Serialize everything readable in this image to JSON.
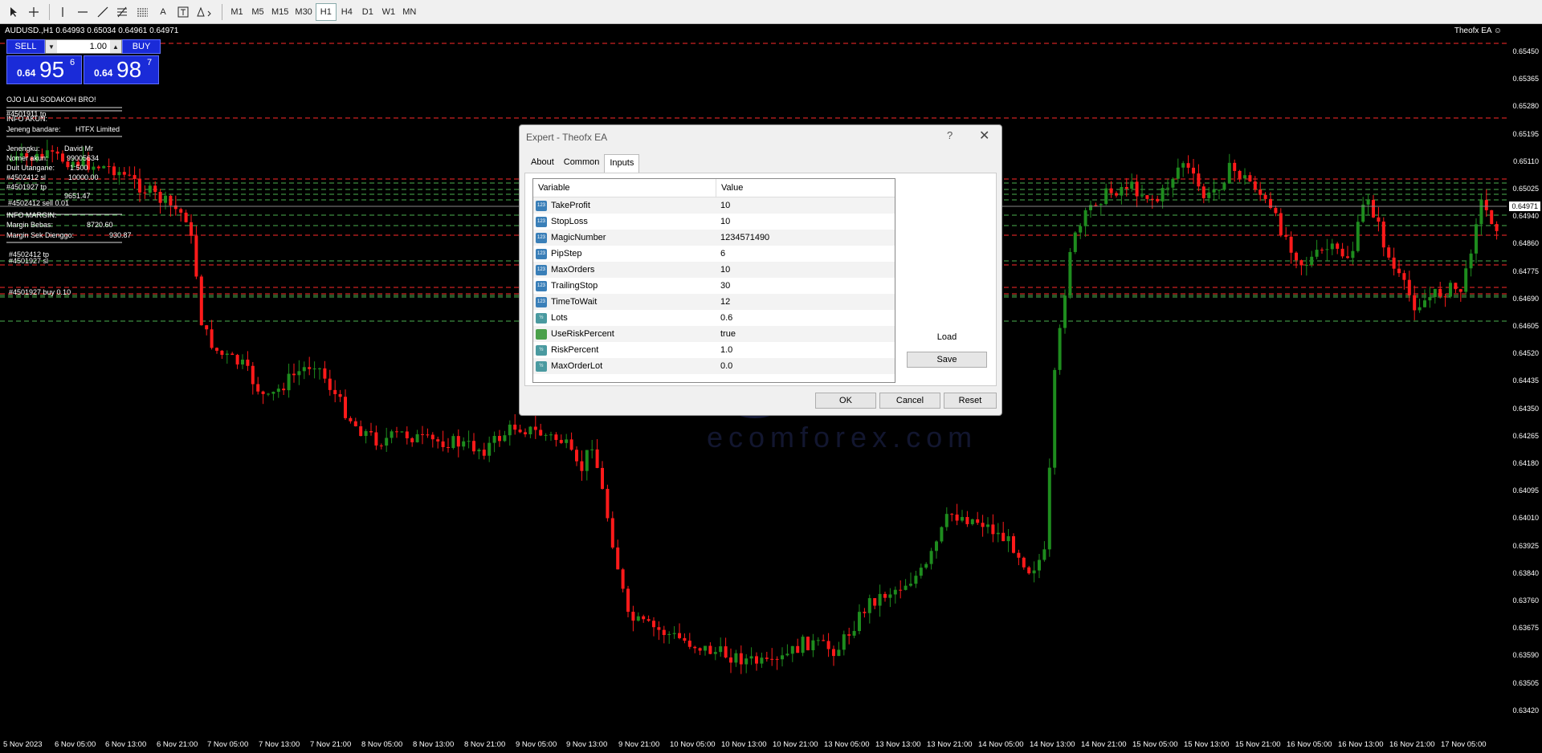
{
  "toolbar": {
    "tools": [
      "cursor-icon",
      "crosshair-icon",
      "vertical-line-icon",
      "horizontal-line-icon",
      "trendline-icon",
      "fibonacci-icon",
      "channel-icon",
      "text-icon",
      "text-label-icon",
      "shapes-icon"
    ],
    "text_label": "A",
    "timeframes": [
      "M1",
      "M5",
      "M15",
      "M30",
      "H1",
      "H4",
      "D1",
      "W1",
      "MN"
    ],
    "active_timeframe": "H1"
  },
  "chart": {
    "symbol_line": "AUDUSD.,H1  0.64993 0.65034 0.64961 0.64971",
    "ea_name": "Theofx EA ☺",
    "current_price": "0.64971",
    "y_ticks": [
      "0.65450",
      "0.65365",
      "0.65280",
      "0.65195",
      "0.65110",
      "0.65025",
      "0.64940",
      "0.64860",
      "0.64775",
      "0.64690",
      "0.64605",
      "0.64520",
      "0.64435",
      "0.64350",
      "0.64265",
      "0.64180",
      "0.64095",
      "0.64010",
      "0.63925",
      "0.63840",
      "0.63760",
      "0.63675",
      "0.63590",
      "0.63505",
      "0.63420"
    ],
    "x_ticks": [
      "5 Nov 2023",
      "6 Nov 05:00",
      "6 Nov 13:00",
      "6 Nov 21:00",
      "7 Nov 05:00",
      "7 Nov 13:00",
      "7 Nov 21:00",
      "8 Nov 05:00",
      "8 Nov 13:00",
      "8 Nov 21:00",
      "9 Nov 05:00",
      "9 Nov 13:00",
      "9 Nov 21:00",
      "10 Nov 05:00",
      "10 Nov 13:00",
      "10 Nov 21:00",
      "13 Nov 05:00",
      "13 Nov 13:00",
      "13 Nov 21:00",
      "14 Nov 05:00",
      "14 Nov 13:00",
      "14 Nov 21:00",
      "15 Nov 05:00",
      "15 Nov 13:00",
      "15 Nov 21:00",
      "16 Nov 05:00",
      "16 Nov 13:00",
      "16 Nov 21:00",
      "17 Nov 05:00"
    ],
    "colors": {
      "bull": "#1e8c1e",
      "bear": "#ff1a1a",
      "sl_line": "#ff2a2a",
      "tp_line": "#4caf50"
    }
  },
  "trade_panel": {
    "sell_label": "SELL",
    "buy_label": "BUY",
    "lot": "1.00",
    "sell_prefix": "0.64",
    "sell_big": "95",
    "sell_sup": "6",
    "buy_prefix": "0.64",
    "buy_big": "98",
    "buy_sup": "7"
  },
  "info_panel": {
    "greeting": "OJO LALI SODAKOH BRO!",
    "account_header": "INFO AKUN:",
    "order_tp_top": "#4501911 tp",
    "broker_label": "Jeneng bandare:",
    "broker_value": "HTFX Limited",
    "name_label": "Jenengku:",
    "name_value": "David Mr",
    "account_label": "Nomer akun:",
    "account_value": "99005634",
    "leverage_label": "Duit Utangane:",
    "leverage_value": "1:500",
    "balance_value": "10000.00",
    "equity_value": "9651.47",
    "margin_header": "INFO MARGIN:",
    "free_margin_label": "Margin Bebas:",
    "free_margin_value": "8720.60",
    "used_margin_label": "Margin Sek Dienggo:",
    "used_margin_value": "930.87",
    "order_sell": "#4502412 sell 0.01",
    "order_tp": "#4502412 tp",
    "order_sl": "#4501927 sl",
    "order_buy": "#4501927 buy 0.10",
    "overlap_1": "#4502412 sl",
    "overlap_2": "#4501927 tp"
  },
  "dialog": {
    "title": "Expert - Theofx EA",
    "help": "?",
    "close": "✕",
    "tabs": [
      "About",
      "Common",
      "Inputs"
    ],
    "active_tab": "Inputs",
    "col_variable": "Variable",
    "col_value": "Value",
    "params": [
      {
        "name": "TakeProfit",
        "value": "10",
        "type": "int"
      },
      {
        "name": "StopLoss",
        "value": "10",
        "type": "int"
      },
      {
        "name": "MagicNumber",
        "value": "1234571490",
        "type": "int"
      },
      {
        "name": "PipStep",
        "value": "6",
        "type": "int"
      },
      {
        "name": "MaxOrders",
        "value": "10",
        "type": "int"
      },
      {
        "name": "TrailingStop",
        "value": "30",
        "type": "int"
      },
      {
        "name": "TimeToWait",
        "value": "12",
        "type": "int"
      },
      {
        "name": "Lots",
        "value": "0.6",
        "type": "double"
      },
      {
        "name": "UseRiskPercent",
        "value": "true",
        "type": "bool"
      },
      {
        "name": "RiskPercent",
        "value": "1.0",
        "type": "double"
      },
      {
        "name": "MaxOrderLot",
        "value": "0.0",
        "type": "double"
      }
    ],
    "load_label": "Load",
    "save_label": "Save",
    "ok_label": "OK",
    "cancel_label": "Cancel",
    "reset_label": "Reset"
  },
  "watermark": {
    "text": "ecomforex.com",
    "logo_text": "m"
  }
}
